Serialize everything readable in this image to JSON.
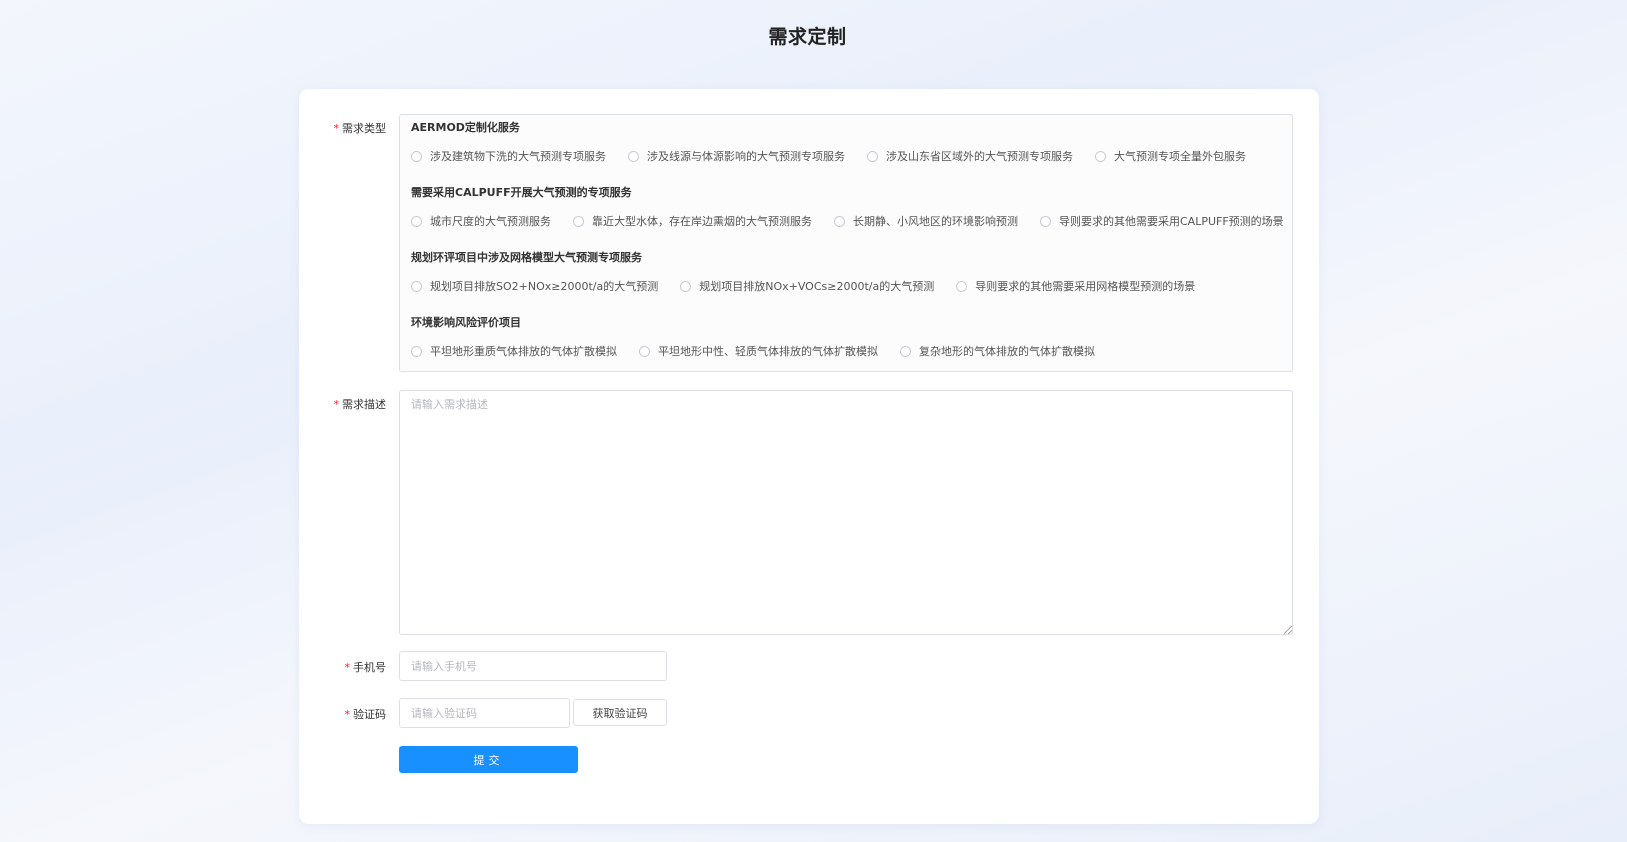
{
  "page": {
    "title": "需求定制"
  },
  "form": {
    "required_mark": "*",
    "type_label": "需求类型",
    "groups": [
      {
        "title": "AERMOD定制化服务",
        "options": [
          "涉及建筑物下洗的大气预测专项服务",
          "涉及线源与体源影响的大气预测专项服务",
          "涉及山东省区域外的大气预测专项服务",
          "大气预测专项全量外包服务"
        ]
      },
      {
        "title": "需要采用CALPUFF开展大气预测的专项服务",
        "options": [
          "城市尺度的大气预测服务",
          "靠近大型水体，存在岸边熏烟的大气预测服务",
          "长期静、小风地区的环境影响预测",
          "导则要求的其他需要采用CALPUFF预测的场景"
        ]
      },
      {
        "title": "规划环评项目中涉及网格模型大气预测专项服务",
        "options": [
          "规划项目排放SO2+NOx≥2000t/a的大气预测",
          "规划项目排放NOx+VOCs≥2000t/a的大气预测",
          "导则要求的其他需要采用网格模型预测的场景"
        ]
      },
      {
        "title": "环境影响风险评价项目",
        "options": [
          "平坦地形重质气体排放的气体扩散模拟",
          "平坦地形中性、轻质气体排放的气体扩散模拟",
          "复杂地形的气体排放的气体扩散模拟"
        ]
      }
    ],
    "description": {
      "label": "需求描述",
      "value": "",
      "placeholder": "请输入需求描述"
    },
    "phone": {
      "label": "手机号",
      "value": "",
      "placeholder": "请输入手机号"
    },
    "code": {
      "label": "验证码",
      "value": "",
      "placeholder": "请输入验证码",
      "button_label": "获取验证码"
    },
    "submit_label": "提交"
  },
  "colors": {
    "accent": "#1890ff",
    "required": "#f5222d",
    "border": "#dcdfe6"
  }
}
